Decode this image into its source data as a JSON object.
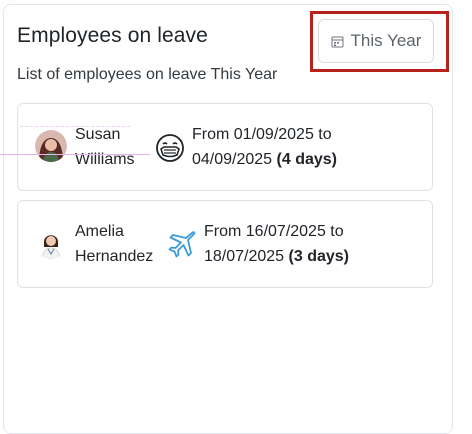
{
  "widget": {
    "title": "Employees on leave",
    "subtitle": "List of employees on leave This Year",
    "filter": {
      "label": "This Year",
      "icon": "calendar-icon"
    }
  },
  "leaves": [
    {
      "first_name": "Susan",
      "last_name": "Williams",
      "avatar": "avatar-photo",
      "type_icon": "sick-mask-icon",
      "date_prefix": "From 01/09/2025 to",
      "date_end": "04/09/2025",
      "duration": "(4 days)"
    },
    {
      "first_name": "Amelia",
      "last_name": "Hernandez",
      "avatar": "avatar-photo",
      "type_icon": "plane-icon",
      "date_prefix": "From 16/07/2025 to",
      "date_end": "18/07/2025",
      "duration": "(3 days)"
    }
  ],
  "colors": {
    "highlight_border": "#b7221d",
    "plane_icon": "#3d9bd6",
    "card_border": "#dee2e6"
  }
}
